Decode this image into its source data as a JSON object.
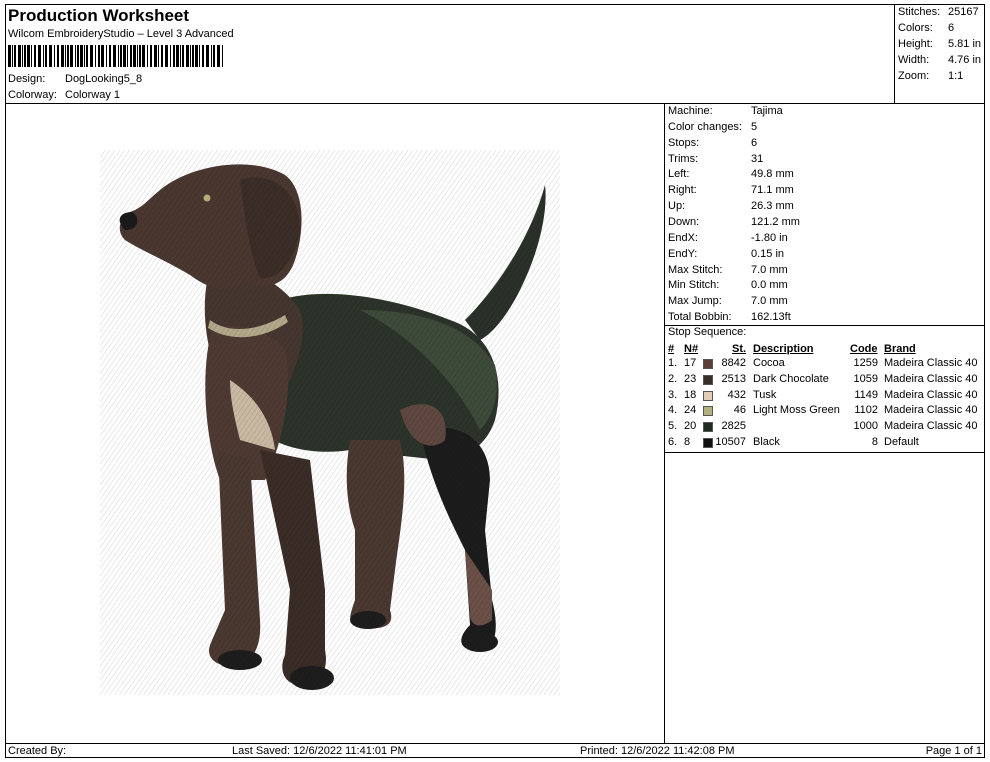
{
  "header": {
    "title": "Production Worksheet",
    "software": "Wilcom EmbroideryStudio – Level 3 Advanced",
    "design_label": "Design:",
    "design_value": "DogLooking5_8",
    "colorway_label": "Colorway:",
    "colorway_value": "Colorway 1"
  },
  "summary": [
    {
      "label": "Stitches:",
      "value": "25167"
    },
    {
      "label": "Colors:",
      "value": "6"
    },
    {
      "label": "Height:",
      "value": "5.81 in"
    },
    {
      "label": "Width:",
      "value": "4.76 in"
    },
    {
      "label": "Zoom:",
      "value": "1:1"
    }
  ],
  "machine_info": [
    {
      "label": "Machine:",
      "value": "Tajima"
    },
    {
      "label": "Color changes:",
      "value": "5"
    },
    {
      "label": "Stops:",
      "value": "6"
    },
    {
      "label": "Trims:",
      "value": "31"
    },
    {
      "label": "Left:",
      "value": "49.8 mm"
    },
    {
      "label": "Right:",
      "value": "71.1 mm"
    },
    {
      "label": "Up:",
      "value": "26.3 mm"
    },
    {
      "label": "Down:",
      "value": "121.2 mm"
    },
    {
      "label": "EndX:",
      "value": "-1.80 in"
    },
    {
      "label": "EndY:",
      "value": "0.15 in"
    },
    {
      "label": "Max Stitch:",
      "value": "7.0 mm"
    },
    {
      "label": "Min Stitch:",
      "value": "0.0 mm"
    },
    {
      "label": "Max Jump:",
      "value": "7.0 mm"
    },
    {
      "label": "Total Bobbin:",
      "value": "162.13ft"
    }
  ],
  "stop_sequence": {
    "title": "Stop Sequence:",
    "columns": {
      "num": "#",
      "n": "N#",
      "st": "St.",
      "desc": "Description",
      "code": "Code",
      "brand": "Brand"
    },
    "rows": [
      {
        "num": "1.",
        "n": "17",
        "color": "#5a4038",
        "st": "8842",
        "desc": "Cocoa",
        "code": "1259",
        "brand": "Madeira Classic 40"
      },
      {
        "num": "2.",
        "n": "23",
        "color": "#3a2e28",
        "st": "2513",
        "desc": "Dark Chocolate",
        "code": "1059",
        "brand": "Madeira Classic 40"
      },
      {
        "num": "3.",
        "n": "18",
        "color": "#e2cdb8",
        "st": "432",
        "desc": "Tusk",
        "code": "1149",
        "brand": "Madeira Classic 40"
      },
      {
        "num": "4.",
        "n": "24",
        "color": "#b4b07c",
        "st": "46",
        "desc": "Light Moss Green",
        "code": "1102",
        "brand": "Madeira Classic 40"
      },
      {
        "num": "5.",
        "n": "20",
        "color": "#1f2a22",
        "st": "2825",
        "desc": "",
        "code": "1000",
        "brand": "Madeira Classic 40"
      },
      {
        "num": "6.",
        "n": "8",
        "color": "#111111",
        "st": "10507",
        "desc": "Black",
        "code": "8",
        "brand": "Default"
      }
    ]
  },
  "footer": {
    "created_by": "Created By:",
    "last_saved": "Last Saved: 12/6/2022 11:41:01 PM",
    "printed": "Printed: 12/6/2022 11:42:08 PM",
    "page": "Page 1 of 1"
  }
}
